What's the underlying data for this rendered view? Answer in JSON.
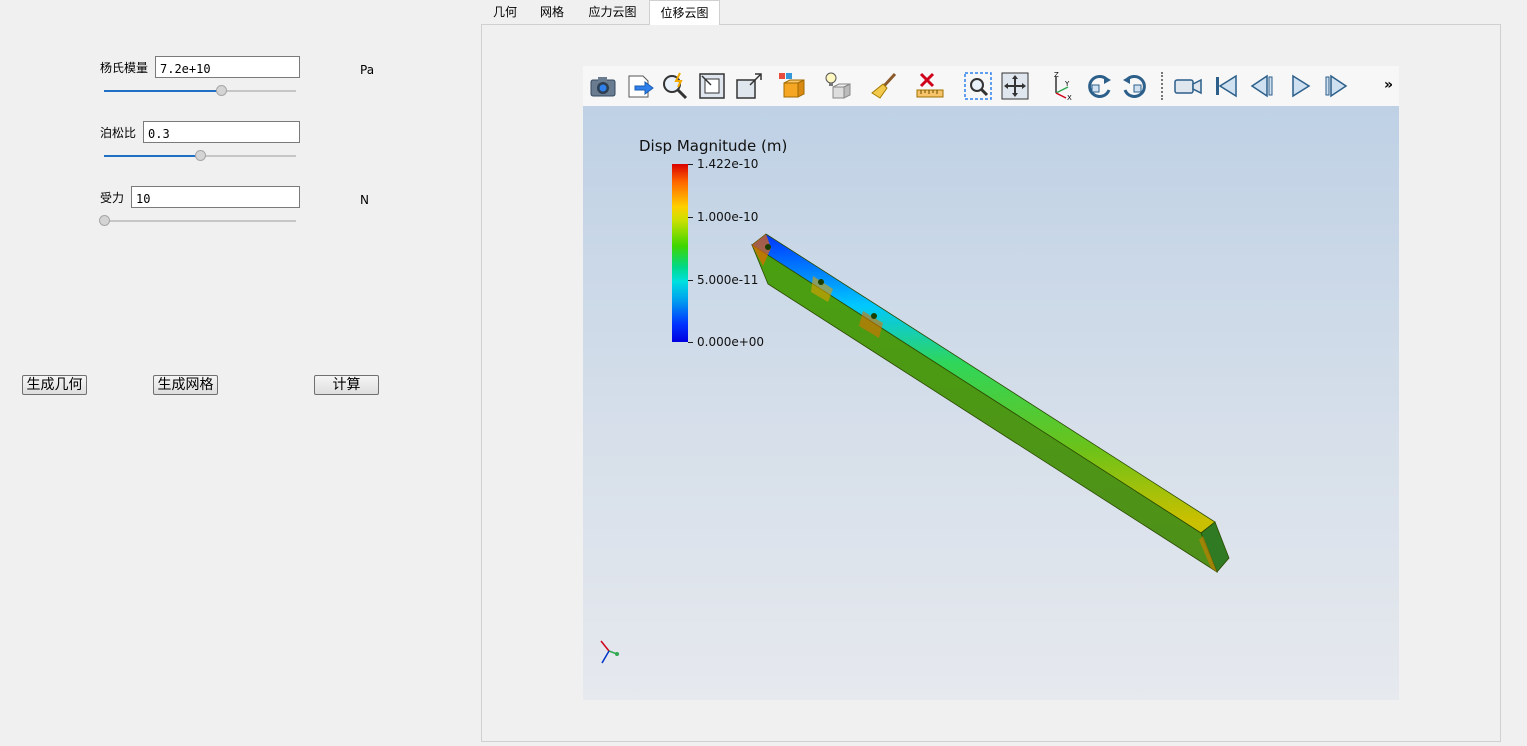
{
  "tabs": [
    "几何",
    "网格",
    "应力云图",
    "位移云图"
  ],
  "active_tab": "位移云图",
  "params": {
    "youngs": {
      "label": "杨氏模量",
      "value": "7.2e+10",
      "unit": "Pa",
      "slider": 0.61
    },
    "poisson": {
      "label": "泊松比",
      "value": "0.3",
      "slider": 0.5
    },
    "force": {
      "label": "受力",
      "value": "10",
      "unit": "N",
      "slider": 0.0
    }
  },
  "buttons": {
    "geometry": "生成几何",
    "mesh": "生成网格",
    "compute": "计算"
  },
  "toolbar": {
    "overflow": "»",
    "icons": [
      "camera-icon",
      "export-icon",
      "interactive-select-icon",
      "reset-camera-icon",
      "zoom-to-box-icon",
      "cube-orange-icon",
      "light-icon",
      "cleanup-brush-icon",
      "delete-ruler-icon",
      "zoom-to-data-icon",
      "fit-view-icon",
      "axes-orientation-icon",
      "rotate-cw-icon",
      "rotate-ccw-icon",
      "video-camera-icon",
      "first-frame-icon",
      "previous-frame-icon",
      "play-icon",
      "next-frame-icon"
    ]
  },
  "legend": {
    "title": "Disp Magnitude (m)",
    "max_label": "1.422e-10",
    "ticks": [
      "1.422e-10",
      "1.000e-10",
      "5.000e-11",
      "0.000e+00"
    ],
    "tick_values": [
      1.422e-10,
      1e-10,
      5e-11,
      0.0
    ],
    "range": [
      0.0,
      1.422e-10
    ]
  },
  "colors": {
    "accent": "#1f6fc4",
    "viewer_bg_top": "#bfd1e5",
    "viewer_bg_bottom": "#e6e9ee"
  }
}
